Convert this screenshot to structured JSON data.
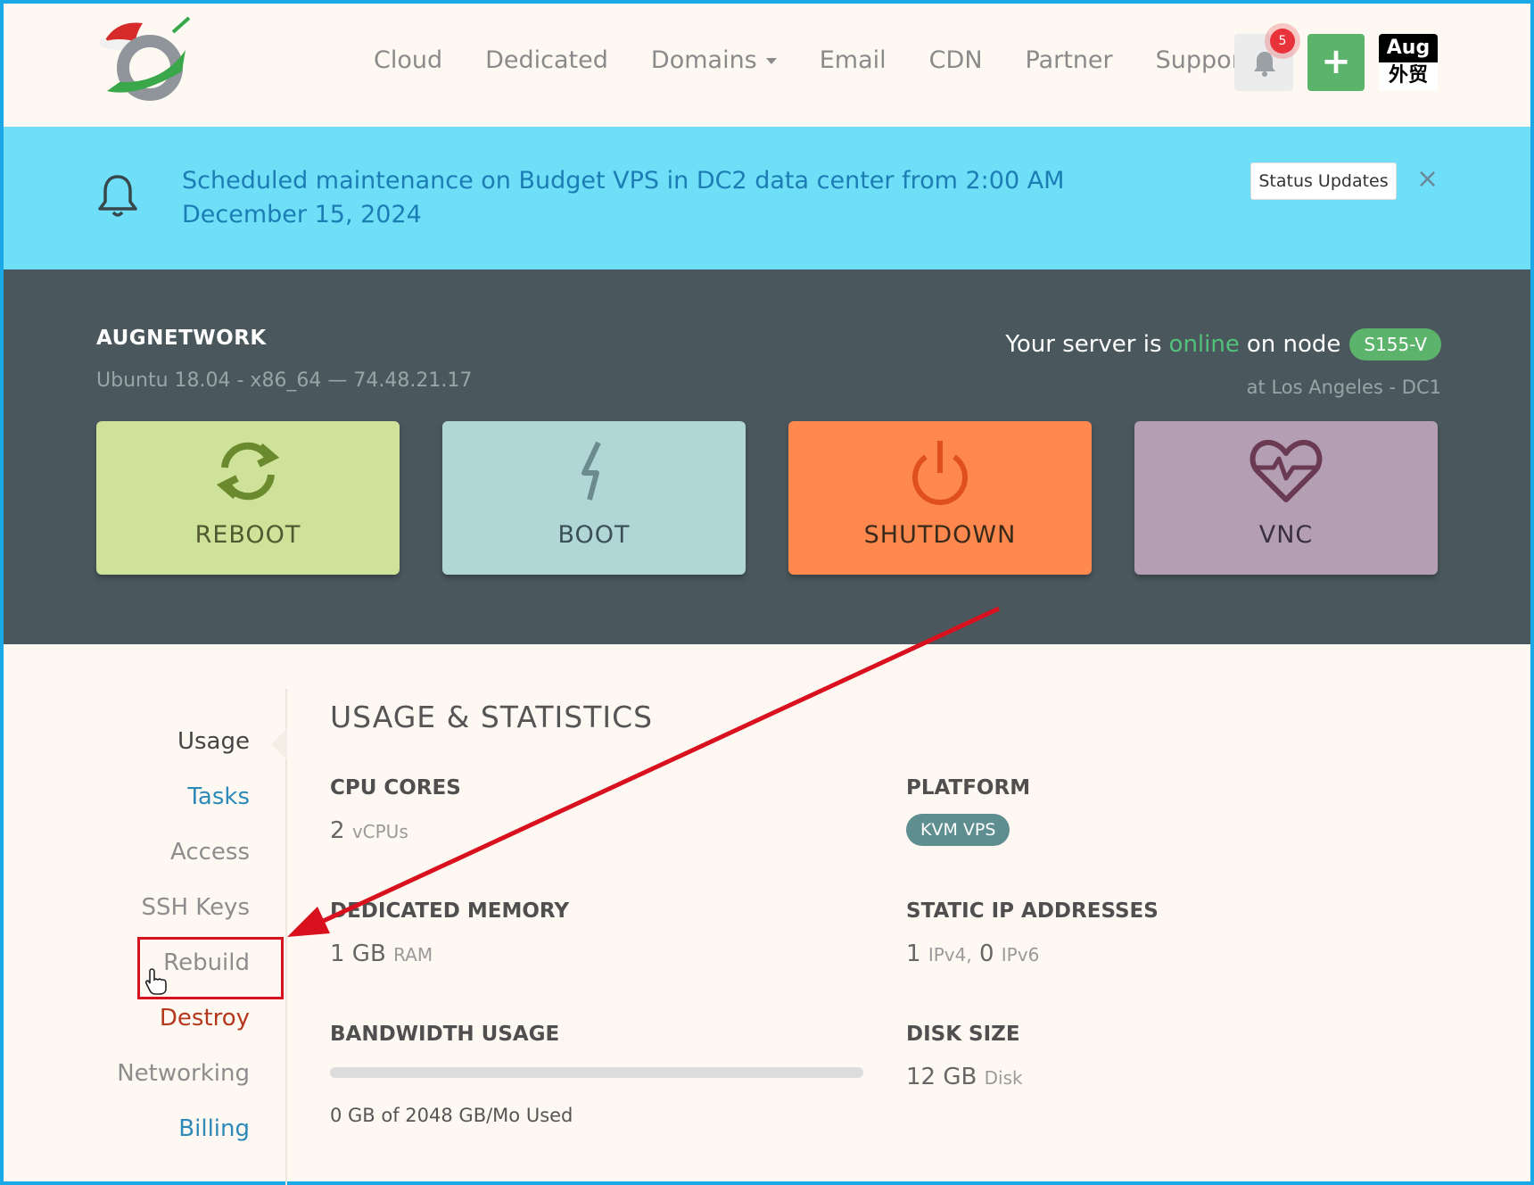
{
  "nav": {
    "links": [
      "Cloud",
      "Dedicated",
      "Domains",
      "Email",
      "CDN",
      "Partner",
      "Support"
    ],
    "notification_count": "5",
    "plus_label": "+",
    "brand_badge": {
      "line1": "Aug",
      "line2": "外贸"
    }
  },
  "banner": {
    "message": "Scheduled maintenance on Budget VPS in DC2 data center from 2:00 AM December 15, 2024",
    "status_button": "Status Updates",
    "close_label": "×"
  },
  "server": {
    "name": "AUGNETWORK",
    "info": "Ubuntu 18.04 - x86_64 — 74.48.21.17",
    "status_prefix": "Your server is",
    "status_word": "online",
    "status_mid": "on node",
    "node": "S155-V",
    "location": "at Los Angeles - DC1",
    "status_color": "#52c27a"
  },
  "actions": {
    "reboot": "REBOOT",
    "boot": "BOOT",
    "shutdown": "SHUTDOWN",
    "vnc": "VNC"
  },
  "sidebar": {
    "items": [
      {
        "label": "Usage",
        "color": "#444444"
      },
      {
        "label": "Tasks",
        "color": "#2d89b8"
      },
      {
        "label": "Access",
        "color": "#8d8d8d"
      },
      {
        "label": "SSH Keys",
        "color": "#8d8d8d"
      },
      {
        "label": "Rebuild",
        "color": "#8d8d8d"
      },
      {
        "label": "Destroy",
        "color": "#b5371c"
      },
      {
        "label": "Networking",
        "color": "#8d8d8d"
      },
      {
        "label": "Billing",
        "color": "#2d89b8"
      }
    ]
  },
  "usage": {
    "title": "USAGE & STATISTICS",
    "cpu": {
      "heading": "CPU CORES",
      "value": "2",
      "unit": "vCPUs"
    },
    "platform": {
      "heading": "PLATFORM",
      "value": "KVM VPS"
    },
    "memory": {
      "heading": "DEDICATED MEMORY",
      "value": "1 GB",
      "unit": "RAM"
    },
    "ips": {
      "heading": "STATIC IP ADDRESSES",
      "v4": "1",
      "v4_unit": "IPv4,",
      "v6": "0",
      "v6_unit": "IPv6"
    },
    "bandwidth": {
      "heading": "BANDWIDTH USAGE",
      "used_fraction": 0,
      "text": "0 GB of 2048 GB/Mo Used"
    },
    "disk": {
      "heading": "DISK SIZE",
      "value": "12 GB",
      "unit": "Disk"
    }
  }
}
